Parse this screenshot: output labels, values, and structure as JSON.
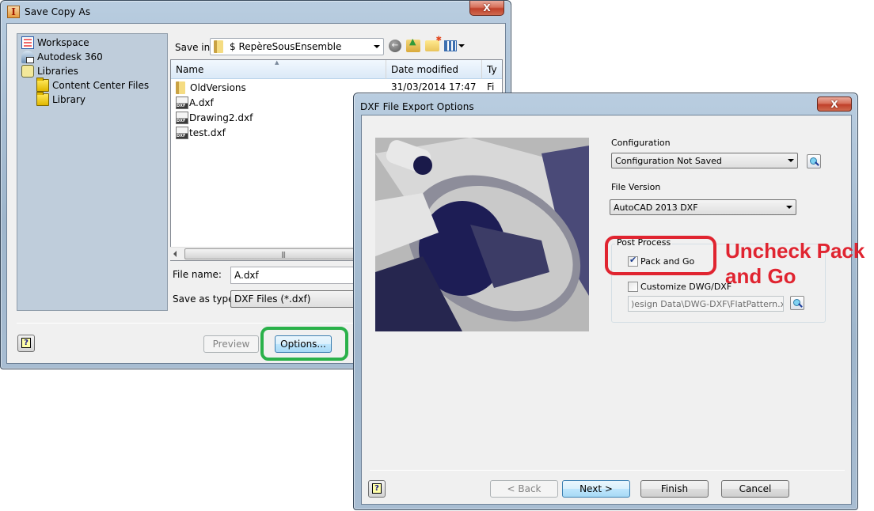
{
  "save_dialog": {
    "title": "Save Copy As",
    "places": [
      {
        "label": "Workspace",
        "icon": "workspace-icon"
      },
      {
        "label": "Autodesk 360",
        "icon": "cloud-icon"
      },
      {
        "label": "Libraries",
        "icon": "libraries-icon"
      },
      {
        "label": "Content Center Files",
        "icon": "folder-icon"
      },
      {
        "label": "Library",
        "icon": "folder-icon"
      }
    ],
    "save_in_label": "Save in:",
    "save_in_value": "$ RepèreSousEnsemble",
    "columns": {
      "name": "Name",
      "date_modified": "Date modified",
      "type": "Ty"
    },
    "files": [
      {
        "name": "OldVersions",
        "icon": "folder-icon",
        "date": "31/03/2014 17:47",
        "type": "Fi"
      },
      {
        "name": "A.dxf",
        "icon": "dxf-file-icon",
        "date": "",
        "type": ""
      },
      {
        "name": "Drawing2.dxf",
        "icon": "dxf-file-icon",
        "date": "",
        "type": ""
      },
      {
        "name": "test.dxf",
        "icon": "dxf-file-icon",
        "date": "",
        "type": ""
      }
    ],
    "file_name_label": "File name:",
    "file_name_value": "A.dxf",
    "save_as_type_label": "Save as type:",
    "save_as_type_value": "DXF Files (*.dxf)",
    "preview_button": "Preview",
    "options_button": "Options...",
    "close_glyph": "X"
  },
  "dxf_dialog": {
    "title": "DXF File Export Options",
    "configuration_label": "Configuration",
    "configuration_value": "Configuration Not Saved",
    "file_version_label": "File Version",
    "file_version_value": "AutoCAD 2013 DXF",
    "post_process_label": "Post Process",
    "pack_and_go_label": "Pack and Go",
    "pack_and_go_checked": true,
    "customize_label": "Customize DWG/DXF",
    "customize_checked": false,
    "customize_path": ")esign Data\\DWG-DXF\\FlatPattern.xml",
    "back_button": "< Back",
    "next_button": "Next >",
    "finish_button": "Finish",
    "cancel_button": "Cancel",
    "close_glyph": "X"
  },
  "annotations": {
    "red_note": "Uncheck Pack and Go",
    "red_color": "#e02430",
    "green_color": "#2ab14a"
  }
}
